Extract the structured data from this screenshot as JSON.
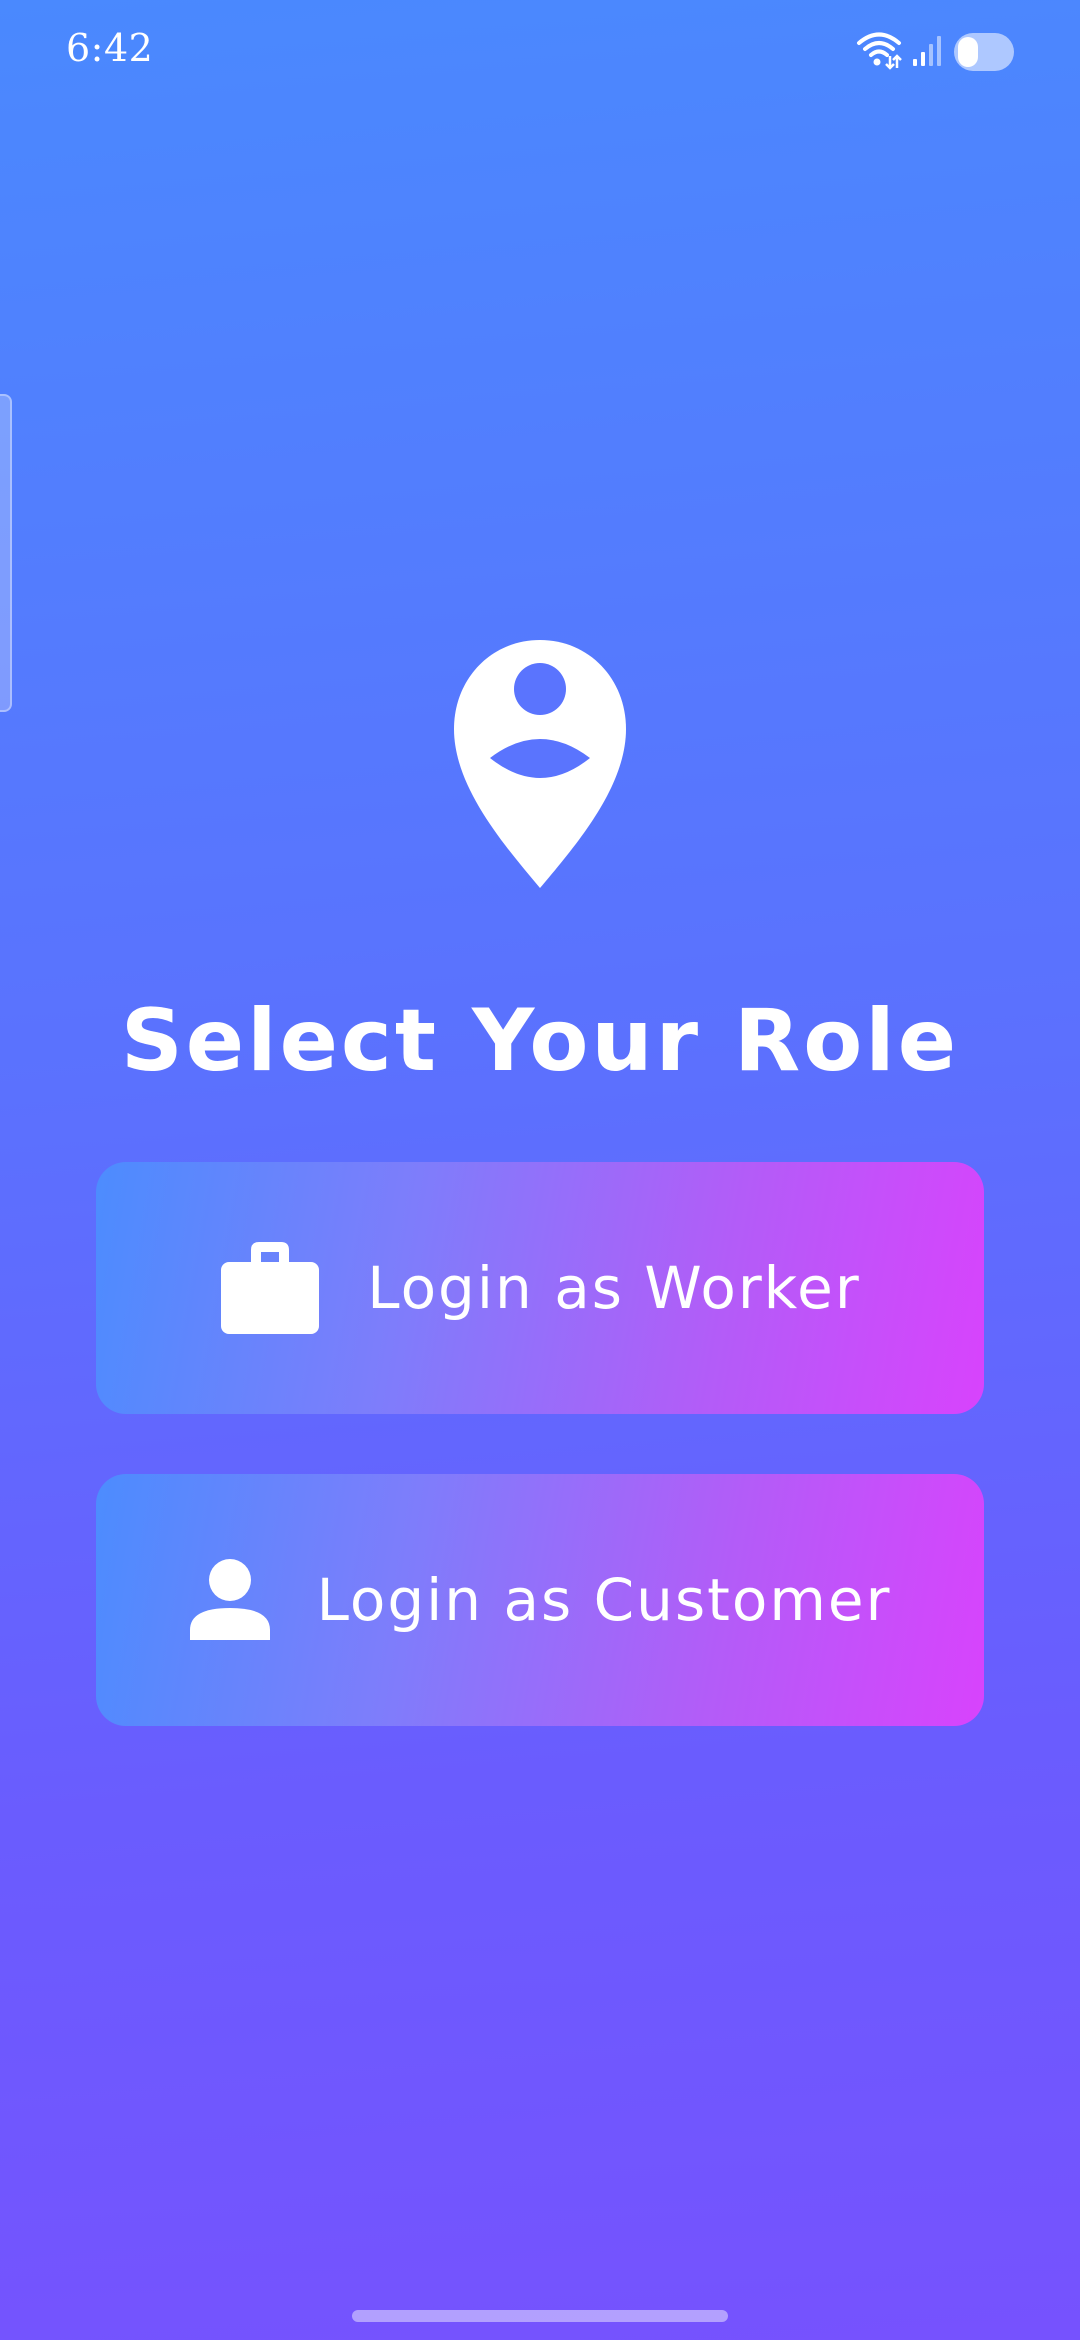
{
  "status_bar": {
    "time": "6:42",
    "icons": [
      "wifi-icon",
      "signal-icon",
      "battery-icon"
    ]
  },
  "hero": {
    "icon": "location-person-pin-icon",
    "title": "Select Your Role"
  },
  "roles": [
    {
      "label": "Login as Worker",
      "icon": "briefcase-icon"
    },
    {
      "label": "Login as Customer",
      "icon": "person-icon"
    }
  ],
  "colors": {
    "background_top": "#4a89fe",
    "background_bottom": "#7652fe",
    "button_gradient_start": "#4c8cfe",
    "button_gradient_end": "#d843fc",
    "text": "#ffffff"
  }
}
